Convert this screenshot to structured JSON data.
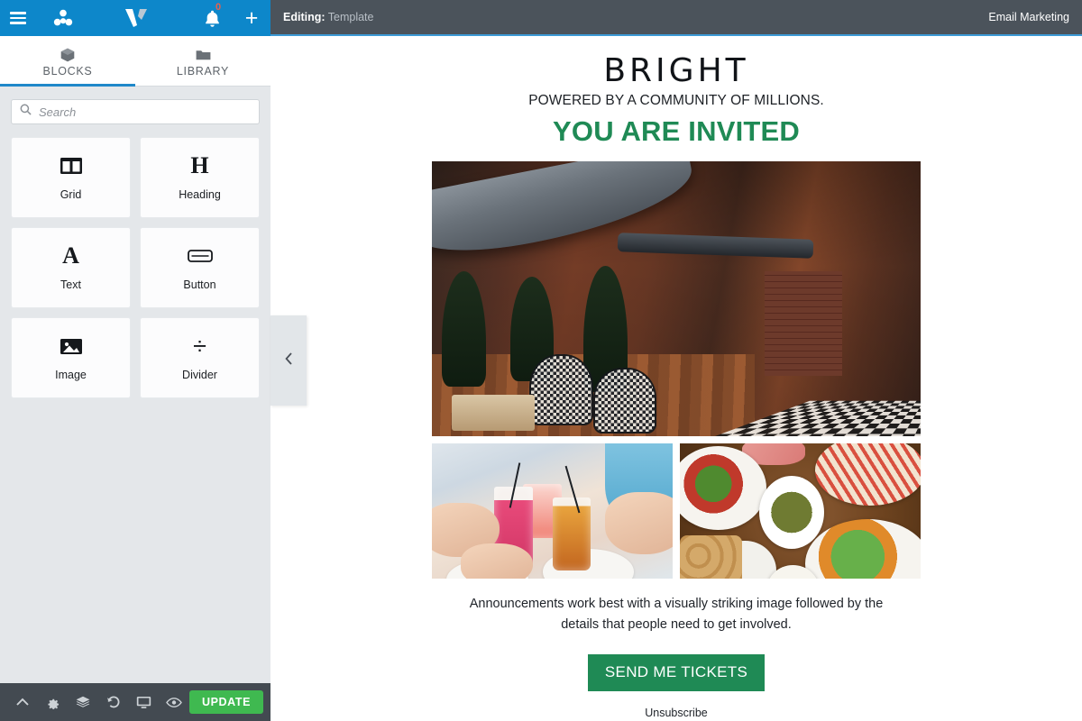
{
  "topbar": {
    "menu_icon": "hamburger-icon",
    "apps_icon": "molecule-icon",
    "logo_icon": "v-logo-icon",
    "notifications_icon": "bell-icon",
    "notifications_count": "0",
    "add_icon": "plus-icon",
    "accent_color": "#0d87ca",
    "badge_color": "#e8604c"
  },
  "sidebar": {
    "tabs": [
      {
        "label": "BLOCKS",
        "icon": "cube-icon",
        "active": true
      },
      {
        "label": "LIBRARY",
        "icon": "folder-icon",
        "active": false
      }
    ],
    "search": {
      "placeholder": "Search",
      "value": "",
      "icon": "search-icon"
    },
    "blocks": [
      {
        "label": "Grid",
        "icon": "grid-icon"
      },
      {
        "label": "Heading",
        "icon": "heading-h-icon"
      },
      {
        "label": "Text",
        "icon": "text-a-icon"
      },
      {
        "label": "Button",
        "icon": "button-icon"
      },
      {
        "label": "Image",
        "icon": "image-icon"
      },
      {
        "label": "Divider",
        "icon": "divider-icon"
      }
    ]
  },
  "bottombar": {
    "icons": [
      {
        "name": "chevron-up-icon"
      },
      {
        "name": "gear-icon"
      },
      {
        "name": "layers-icon"
      },
      {
        "name": "history-icon"
      },
      {
        "name": "desktop-preview-icon"
      },
      {
        "name": "eye-preview-icon"
      }
    ],
    "update_label": "UPDATE",
    "update_color": "#3fb950"
  },
  "collapse_handle": {
    "icon": "chevron-left-icon"
  },
  "main_header": {
    "editing_label": "Editing:",
    "editing_value": "Template",
    "app_name": "Email Marketing",
    "background": "#4b535b",
    "underline_color": "#3d9ad6"
  },
  "email": {
    "logo": "BRIGHT",
    "tagline": "POWERED BY A COMMUNITY OF MILLIONS.",
    "heading": "YOU ARE INVITED",
    "heading_color": "#1f8a55",
    "hero_image_alt": "restaurant-lounge-interior",
    "thumbs": [
      {
        "alt": "friends-toasting-cocktails"
      },
      {
        "alt": "appetizer-platter-spread"
      }
    ],
    "body": "Announcements work best with a visually striking image followed by the details that people need to get involved.",
    "cta_label": "SEND ME TICKETS",
    "cta_color": "#1f8a55",
    "unsubscribe_label": "Unsubscribe"
  }
}
